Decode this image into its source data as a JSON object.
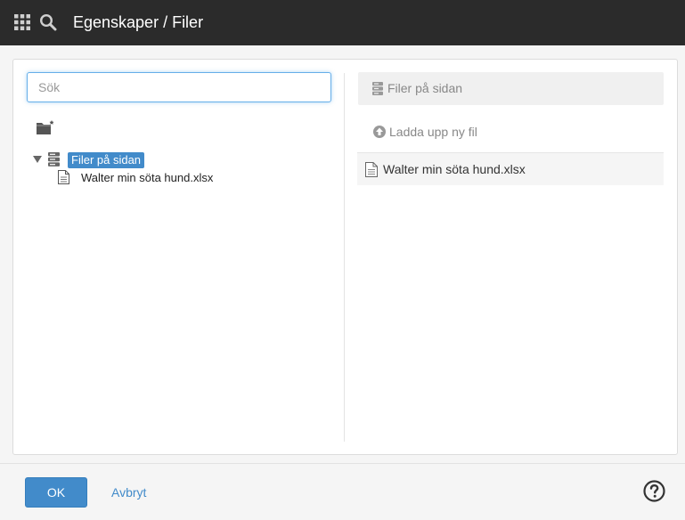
{
  "header": {
    "title": "Egenskaper / Filer",
    "background": "#2b2b2b"
  },
  "left": {
    "search_placeholder": "Sök",
    "tree": {
      "root_label": "Filer på sidan",
      "files": [
        "Walter min söta hund.xlsx"
      ]
    }
  },
  "right": {
    "header_label": "Filer på sidan",
    "upload_label": "Ladda upp ny fil",
    "files": [
      "Walter min söta hund.xlsx"
    ]
  },
  "footer": {
    "ok_label": "OK",
    "cancel_label": "Avbryt"
  },
  "colors": {
    "accent": "#428bca",
    "topbar": "#2b2b2b"
  },
  "icons": [
    "apps-grid-icon",
    "search-icon",
    "new-folder-icon",
    "caret-down-icon",
    "server-icon",
    "file-icon",
    "upload-icon",
    "help-icon"
  ]
}
